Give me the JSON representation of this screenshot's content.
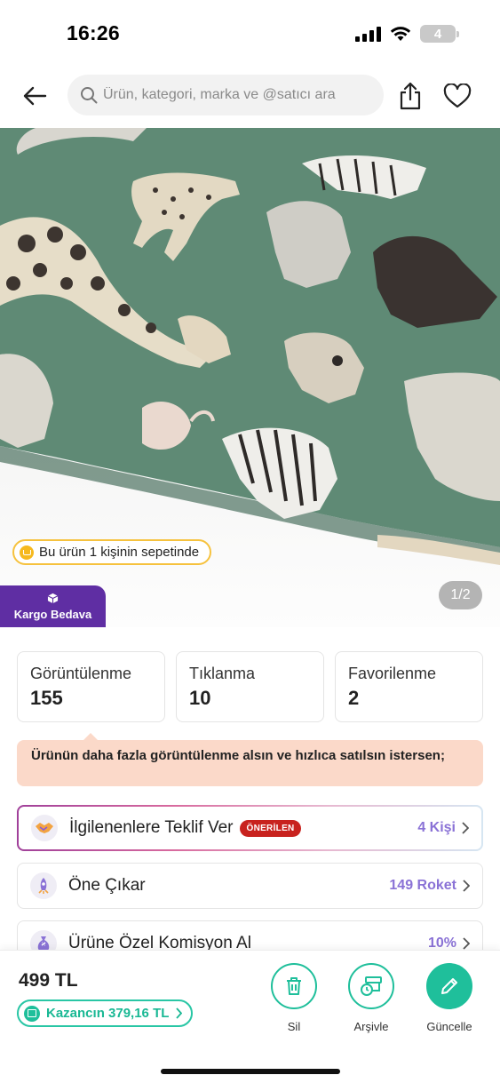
{
  "status_bar": {
    "time": "16:26",
    "battery": "4"
  },
  "header": {
    "search_placeholder": "Ürün, kategori, marka ve @satıcı ara",
    "icons": [
      "back-arrow-icon",
      "search-icon",
      "share-icon",
      "heart-icon"
    ]
  },
  "product_image": {
    "basket_text": "Bu ürün 1 kişinin sepetinde",
    "cargo_label": "Kargo Bedava",
    "page_indicator": "1/2",
    "colors": {
      "fabric": "#5f8a75",
      "cargo": "#5f2ea3",
      "basket_border": "#f6c23e"
    }
  },
  "stats": [
    {
      "label": "Görüntülenme",
      "value": "155"
    },
    {
      "label": "Tıklanma",
      "value": "10"
    },
    {
      "label": "Favorilenme",
      "value": "2"
    }
  ],
  "promo": {
    "text": "Ürünün daha fazla görüntülenme alsın ve hızlıca satılsın istersen;"
  },
  "actions": [
    {
      "label": "İlgilenenlere Teklif Ver",
      "badge": "ÖNERİLEN",
      "right": "4 Kişi",
      "icon": "handshake-icon"
    },
    {
      "label": "Öne Çıkar",
      "right": "149 Roket",
      "icon": "rocket-icon"
    },
    {
      "label": "Ürüne Özel Komisyon Al",
      "right": "10%",
      "icon": "commission-icon"
    }
  ],
  "bottom_bar": {
    "price": "499 TL",
    "earnings": "Kazancın 379,16 TL",
    "buttons": {
      "delete": "Sil",
      "archive": "Arşivle",
      "update": "Güncelle"
    },
    "accent": "#1fbf9b"
  }
}
